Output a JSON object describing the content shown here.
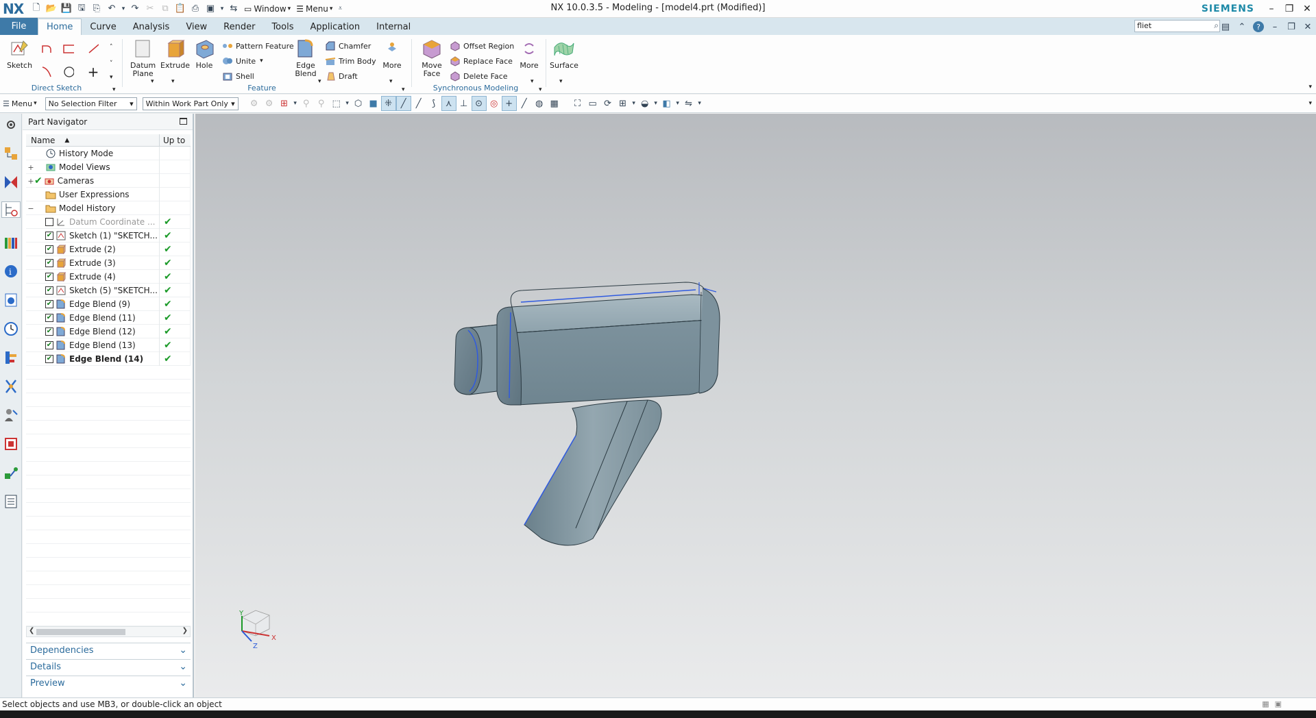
{
  "app": {
    "logo": "NX",
    "title": "NX 10.0.3.5 - Modeling - [model4.prt (Modified)]",
    "brand": "SIEMENS",
    "quick_access": {
      "window_label": "Window",
      "menu_label": "Menu"
    }
  },
  "tabs": [
    "File",
    "Home",
    "Curve",
    "Analysis",
    "View",
    "Render",
    "Tools",
    "Application",
    "Internal"
  ],
  "active_tab": "Home",
  "search": {
    "value": "fliet"
  },
  "ribbon": {
    "sketch_label": "Sketch",
    "direct_sketch_label": "Direct Sketch",
    "datum_plane_label": "Datum\nPlane",
    "extrude_label": "Extrude",
    "hole_label": "Hole",
    "pattern_feature_label": "Pattern Feature",
    "unite_label": "Unite",
    "shell_label": "Shell",
    "edge_blend_label": "Edge\nBlend",
    "chamfer_label": "Chamfer",
    "trim_body_label": "Trim Body",
    "draft_label": "Draft",
    "more_label": "More",
    "feature_label": "Feature",
    "move_face_label": "Move\nFace",
    "offset_region_label": "Offset Region",
    "replace_face_label": "Replace Face",
    "delete_face_label": "Delete Face",
    "more2_label": "More",
    "sync_modeling_label": "Synchronous Modeling",
    "surface_label": "Surface"
  },
  "selection_bar": {
    "menu_label": "Menu",
    "type_filter": "No Selection Filter",
    "scope_filter": "Within Work Part Only"
  },
  "part_navigator": {
    "title": "Part Navigator",
    "col_name": "Name",
    "col_upto": "Up to",
    "rows": [
      {
        "label": "History Mode",
        "indent": 1,
        "icon": "clock",
        "checkbox": "none",
        "upto": false,
        "expander": ""
      },
      {
        "label": "Model Views",
        "indent": 1,
        "icon": "views",
        "checkbox": "none",
        "upto": false,
        "expander": "+"
      },
      {
        "label": "Cameras",
        "indent": 1,
        "icon": "camera",
        "checkbox": "tick",
        "upto": false,
        "expander": "+"
      },
      {
        "label": "User Expressions",
        "indent": 1,
        "icon": "folder",
        "checkbox": "none",
        "upto": false,
        "expander": ""
      },
      {
        "label": "Model History",
        "indent": 1,
        "icon": "folder",
        "checkbox": "none",
        "upto": false,
        "expander": "−"
      },
      {
        "label": "Datum Coordinate ...",
        "indent": 2,
        "icon": "datum",
        "checkbox": "empty",
        "upto": true,
        "expander": "",
        "style": "grey"
      },
      {
        "label": "Sketch (1) \"SKETCH...",
        "indent": 2,
        "icon": "sketch",
        "checkbox": "checked",
        "upto": true,
        "expander": ""
      },
      {
        "label": "Extrude (2)",
        "indent": 2,
        "icon": "extrude",
        "checkbox": "checked",
        "upto": true,
        "expander": ""
      },
      {
        "label": "Extrude (3)",
        "indent": 2,
        "icon": "extrude",
        "checkbox": "checked",
        "upto": true,
        "expander": ""
      },
      {
        "label": "Extrude (4)",
        "indent": 2,
        "icon": "extrude",
        "checkbox": "checked",
        "upto": true,
        "expander": ""
      },
      {
        "label": "Sketch (5) \"SKETCH...",
        "indent": 2,
        "icon": "sketch",
        "checkbox": "checked",
        "upto": true,
        "expander": ""
      },
      {
        "label": "Edge Blend (9)",
        "indent": 2,
        "icon": "blend",
        "checkbox": "checked",
        "upto": true,
        "expander": ""
      },
      {
        "label": "Edge Blend (11)",
        "indent": 2,
        "icon": "blend",
        "checkbox": "checked",
        "upto": true,
        "expander": ""
      },
      {
        "label": "Edge Blend (12)",
        "indent": 2,
        "icon": "blend",
        "checkbox": "checked",
        "upto": true,
        "expander": ""
      },
      {
        "label": "Edge Blend (13)",
        "indent": 2,
        "icon": "blend",
        "checkbox": "checked",
        "upto": true,
        "expander": ""
      },
      {
        "label": "Edge Blend (14)",
        "indent": 2,
        "icon": "blend",
        "checkbox": "checked",
        "upto": true,
        "expander": "",
        "style": "bold"
      }
    ],
    "panels": [
      "Dependencies",
      "Details",
      "Preview"
    ]
  },
  "triad": {
    "x": "X",
    "y": "Y",
    "z": "Z"
  },
  "status": {
    "message": "Select objects and use MB3, or double-click an object"
  },
  "colors": {
    "accent": "#2b6b9c",
    "file_tab": "#3e7aa8",
    "brand": "#1e8aa8",
    "check": "#1b9a28",
    "model_face": "#8a9ea8"
  }
}
